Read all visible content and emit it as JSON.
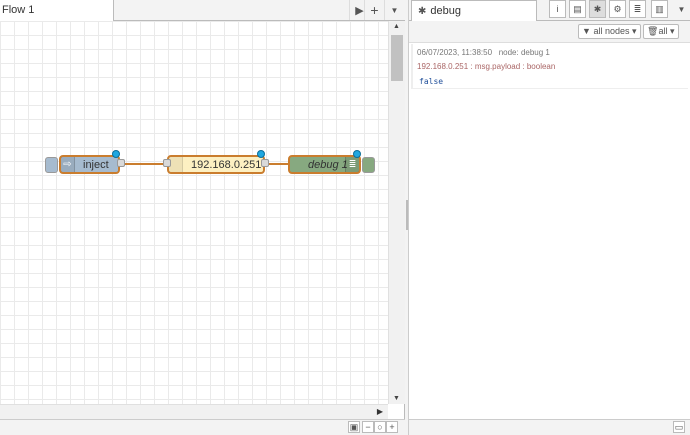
{
  "workspace": {
    "tab_label": "Flow 1",
    "tab_buttons": [
      "▶",
      "+",
      "▼"
    ],
    "nodes": {
      "inject": {
        "label": "inject",
        "color": "#a6bbcf"
      },
      "function": {
        "label": "192.168.0.251",
        "color": "#fdf0c2"
      },
      "debug": {
        "label": "debug 1",
        "color": "#87a980"
      }
    },
    "footer_buttons": [
      "▣",
      "−",
      "○",
      "+"
    ]
  },
  "sidebar": {
    "title": "debug",
    "icons": [
      "i",
      "▤",
      "✱",
      "⚙",
      "≣",
      "▥",
      "▼"
    ],
    "filter_nodes": "all nodes",
    "filter_clear": "all",
    "message": {
      "timestamp": "06/07/2023, 11:38:50",
      "node": "node: debug 1",
      "topic": "192.168.0.251 : msg.payload : boolean",
      "value": "false"
    }
  },
  "colors": {
    "wire": "#ca7d2e",
    "status": "#1fa7e0"
  }
}
